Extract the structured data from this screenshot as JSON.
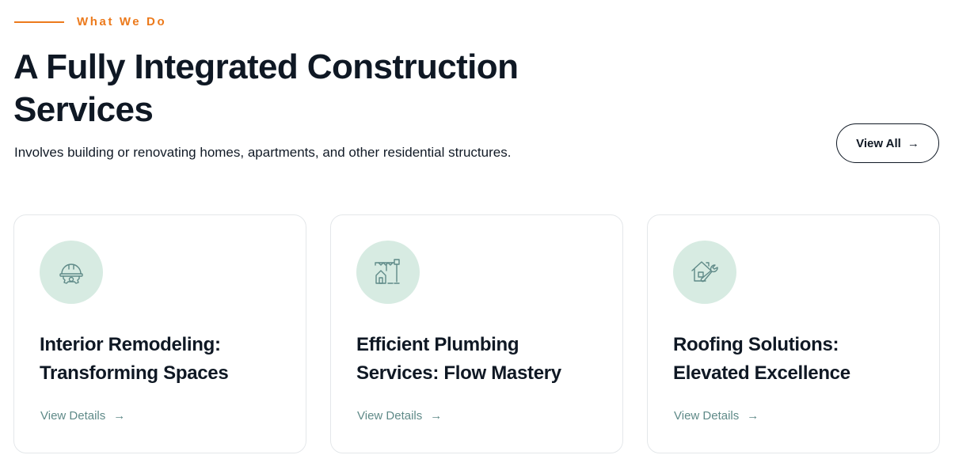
{
  "section": {
    "eyebrow": "What We Do",
    "title": "A Fully Integrated Construction Services",
    "subtitle": "Involves building or renovating homes, apartments, and other residential structures.",
    "view_all_label": "View All",
    "view_all_icon": "arrow-right-icon"
  },
  "colors": {
    "accent": "#ec7a1c",
    "icon_bg": "#d7ebe2",
    "link": "#5f8a88",
    "heading": "#0f1824"
  },
  "cards": [
    {
      "icon": "hard-hat-gear-icon",
      "title": "Interior Remodeling: Transforming Spaces",
      "link_label": "View Details"
    },
    {
      "icon": "crane-house-icon",
      "title": "Efficient Plumbing Services: Flow Mastery",
      "link_label": "View Details"
    },
    {
      "icon": "house-wrench-icon",
      "title": "Roofing Solutions: Elevated Excellence",
      "link_label": "View Details"
    }
  ]
}
